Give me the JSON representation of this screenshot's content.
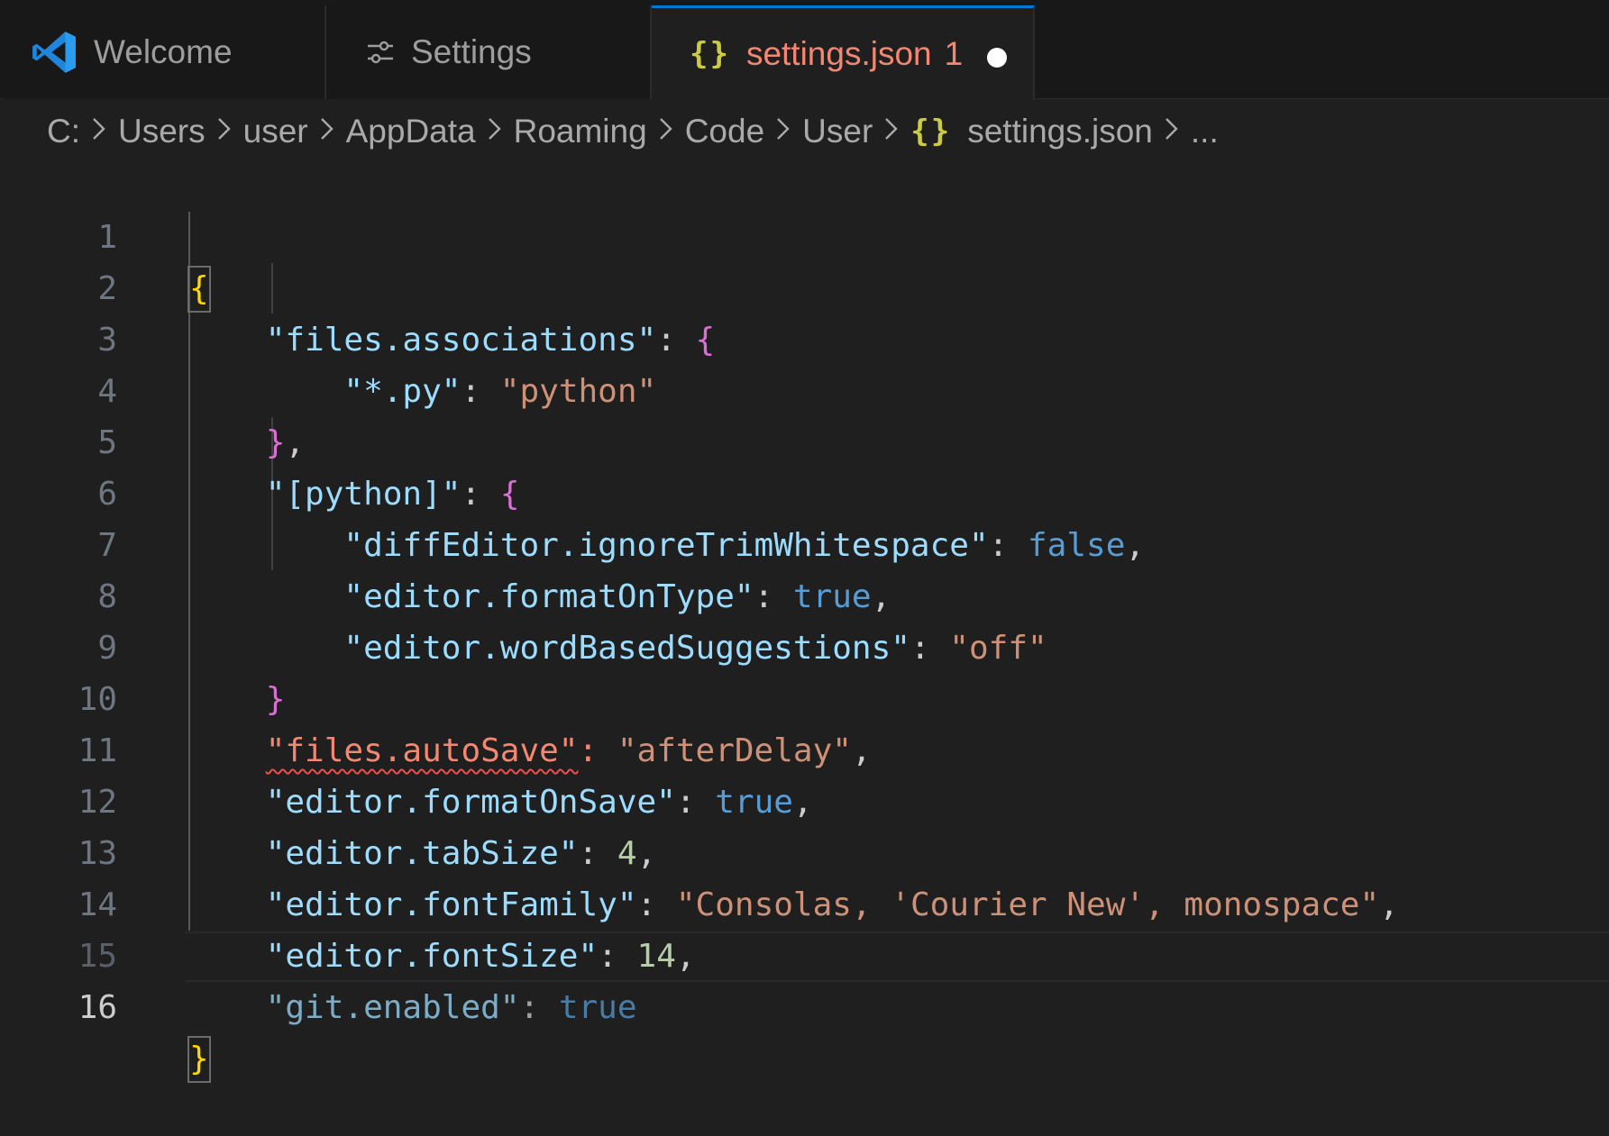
{
  "tabs": [
    {
      "label": "Welcome",
      "icon": "vscode-logo-icon"
    },
    {
      "label": "Settings",
      "icon": "settings-sliders-icon"
    },
    {
      "label": "settings.json",
      "icon": "json-braces-icon",
      "badge": "1",
      "dirty": true
    }
  ],
  "breadcrumb": {
    "items": [
      "C:",
      "Users",
      "user",
      "AppData",
      "Roaming",
      "Code",
      "User"
    ],
    "file_icon": "{}",
    "file": "settings.json",
    "more": "..."
  },
  "editor": {
    "current_line": "16",
    "lines": [
      {
        "num": "1"
      },
      {
        "num": "2",
        "key": "\"files.associations\""
      },
      {
        "num": "3",
        "key": "\"*.py\"",
        "value": "\"python\""
      },
      {
        "num": "4"
      },
      {
        "num": "5",
        "key": "\"[python]\""
      },
      {
        "num": "6",
        "key": "\"diffEditor.ignoreTrimWhitespace\"",
        "value": "false"
      },
      {
        "num": "7",
        "key": "\"editor.formatOnType\"",
        "value": "true"
      },
      {
        "num": "8",
        "key": "\"editor.wordBasedSuggestions\"",
        "value": "\"off\""
      },
      {
        "num": "9"
      },
      {
        "num": "10",
        "key": "\"files.autoSave\"",
        "value": "\"afterDelay\""
      },
      {
        "num": "11",
        "key": "\"editor.formatOnSave\"",
        "value": "true"
      },
      {
        "num": "12",
        "key": "\"editor.tabSize\"",
        "value": "4"
      },
      {
        "num": "13",
        "key": "\"editor.fontFamily\"",
        "value": "\"Consolas, 'Courier New', monospace\""
      },
      {
        "num": "14",
        "key": "\"editor.fontSize\"",
        "value": "14"
      },
      {
        "num": "15",
        "key": "\"git.enabled\"",
        "value": "true"
      },
      {
        "num": "16"
      }
    ]
  },
  "colors": {
    "key": "#9cdcfe",
    "string": "#ce9178",
    "boolean": "#569cd6",
    "number": "#b5cea8",
    "bracket_level1": "#ffd700",
    "bracket_level2": "#da70d6",
    "error": "#f48771",
    "accent": "#0078d4"
  }
}
